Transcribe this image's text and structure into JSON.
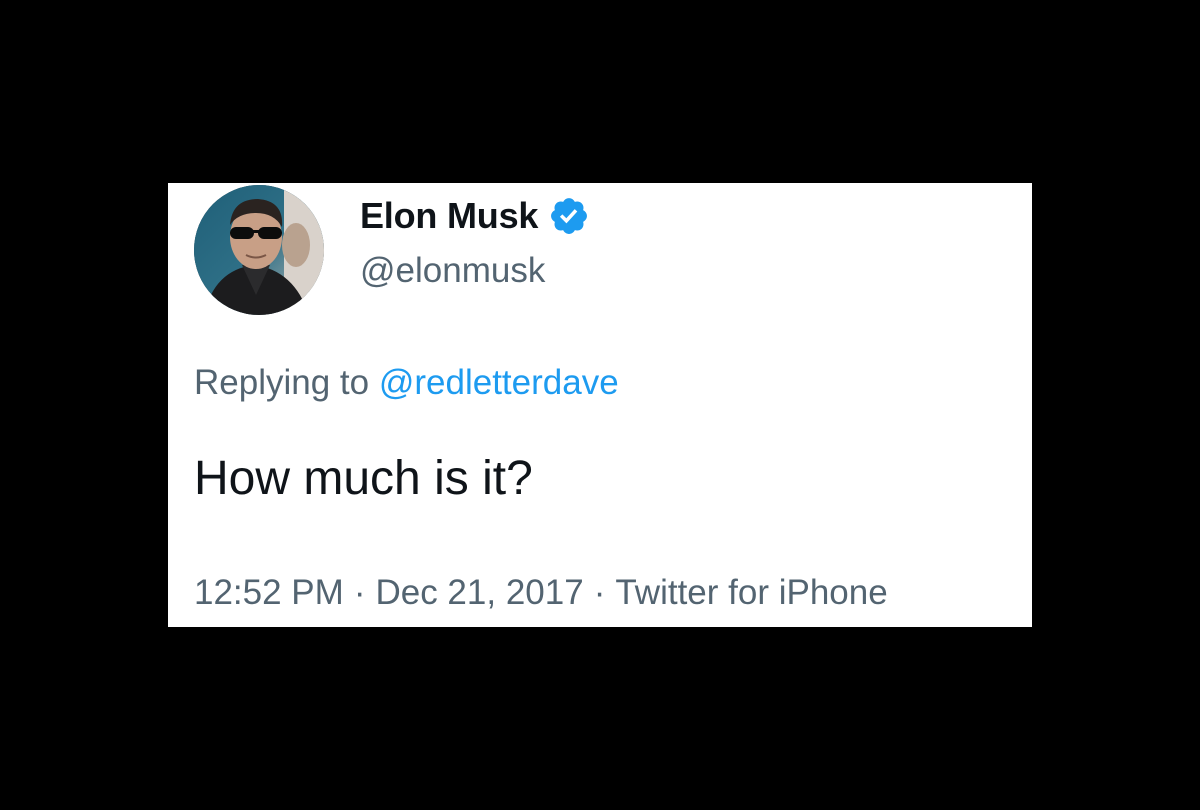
{
  "colors": {
    "background": "#000000",
    "card": "#ffffff",
    "text_primary": "#0f1419",
    "text_secondary": "#536471",
    "accent": "#1d9bf0"
  },
  "tweet": {
    "author": {
      "display_name": "Elon Musk",
      "handle": "@elonmusk",
      "verified_icon": "verified-badge-icon",
      "avatar_icon": "profile-photo"
    },
    "replying_to_label": "Replying to",
    "replying_to_handle": "@redletterdave",
    "text": "How much is it?",
    "time": "12:52 PM",
    "separator": "·",
    "date": "Dec 21, 2017",
    "source": "Twitter for iPhone"
  }
}
